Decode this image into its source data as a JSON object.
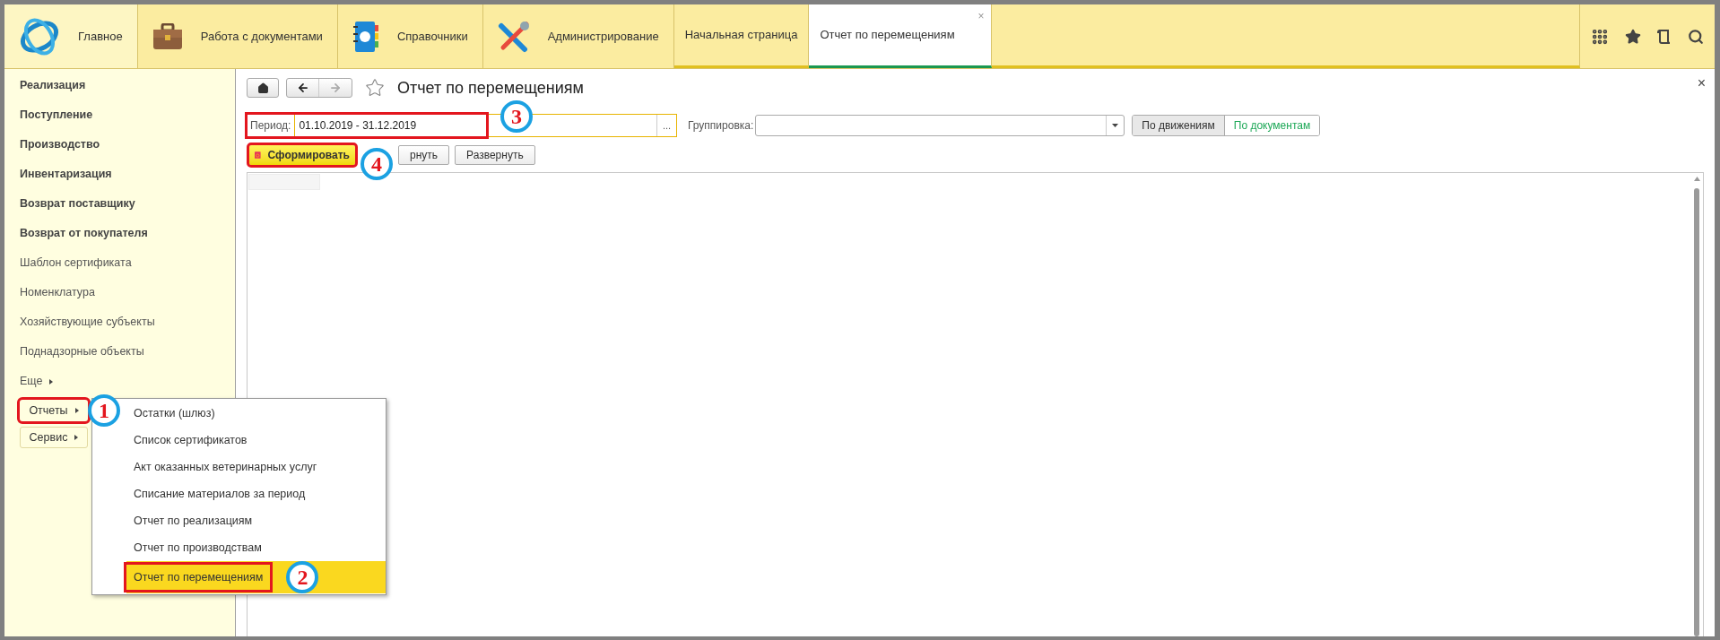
{
  "top_bar": {
    "sections": [
      {
        "label": "Главное",
        "selected": true
      },
      {
        "label": "Работа с документами",
        "selected": false
      },
      {
        "label": "Справочники",
        "selected": false
      },
      {
        "label": "Администрирование",
        "selected": false
      }
    ],
    "tabs": [
      {
        "label": "Начальная страница",
        "selected": false
      },
      {
        "label": "Отчет по перемещениям",
        "selected": true,
        "close": "×"
      }
    ]
  },
  "sidebar": {
    "items": [
      {
        "label": "Реализация",
        "bold": true
      },
      {
        "label": "Поступление",
        "bold": true
      },
      {
        "label": "Производство",
        "bold": true
      },
      {
        "label": "Инвентаризация",
        "bold": true
      },
      {
        "label": "Возврат поставщику",
        "bold": true
      },
      {
        "label": "Возврат от покупателя",
        "bold": true
      },
      {
        "label": "Шаблон сертификата",
        "bold": false
      },
      {
        "label": "Номенклатура",
        "bold": false
      },
      {
        "label": "Хозяйствующие субъекты",
        "bold": false
      },
      {
        "label": "Поднадзорные объекты",
        "bold": false
      }
    ],
    "more": "Еще",
    "buttons": [
      {
        "label": "Отчеты",
        "highlighted": true,
        "marker": "1"
      },
      {
        "label": "Сервис",
        "highlighted": false
      }
    ]
  },
  "popup_menu": {
    "items": [
      {
        "label": "Остатки (шлюз)",
        "selected": false,
        "highlighted": false
      },
      {
        "label": "Список сертификатов",
        "selected": false,
        "highlighted": false
      },
      {
        "label": "Акт оказанных ветеринарных услуг",
        "selected": false,
        "highlighted": false
      },
      {
        "label": "Списание материалов за период",
        "selected": false,
        "highlighted": false
      },
      {
        "label": "Отчет по реализациям",
        "selected": false,
        "highlighted": false
      },
      {
        "label": "Отчет по производствам",
        "selected": false,
        "highlighted": false
      },
      {
        "label": "Отчет по перемещениям",
        "selected": true,
        "highlighted": true,
        "marker": "2"
      }
    ]
  },
  "form": {
    "close": "×",
    "title": "Отчет по перемещениям",
    "period": {
      "label": "Период:",
      "value": "01.10.2019 - 31.12.2019",
      "picker": "...",
      "highlighted": true,
      "marker": "3"
    },
    "grouping": {
      "label": "Группировка:"
    },
    "mode_buttons": [
      {
        "label": "По движениям",
        "selected": true
      },
      {
        "label": "По документам",
        "selected": false
      }
    ],
    "actions": [
      {
        "label": "Сформировать",
        "kind": "primary",
        "highlighted": true,
        "marker": "4"
      },
      {
        "label": "рнуть",
        "kind": "plain",
        "highlighted": false
      },
      {
        "label": "Развернуть",
        "kind": "plain",
        "highlighted": false
      }
    ]
  }
}
